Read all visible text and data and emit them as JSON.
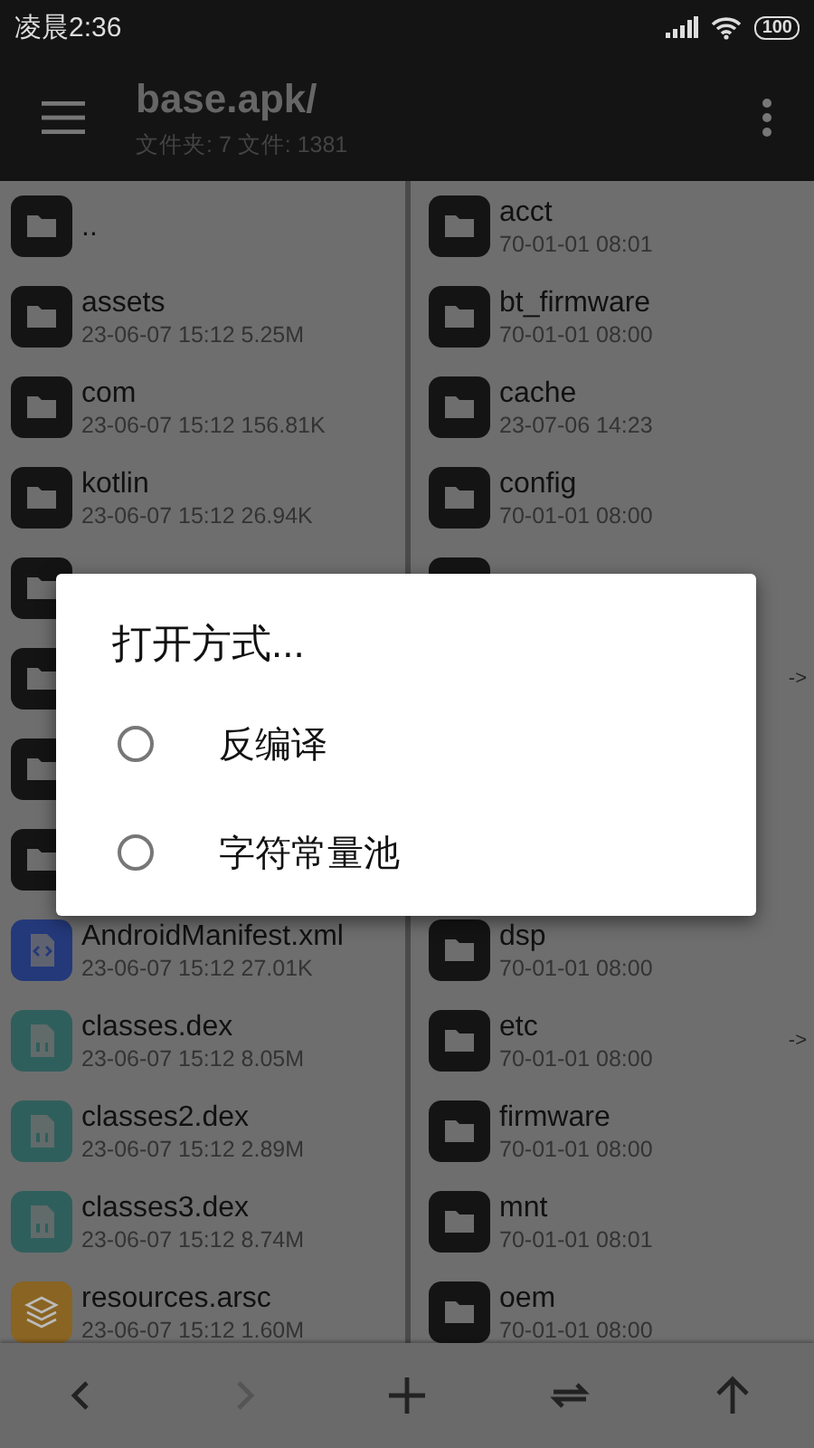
{
  "status_bar": {
    "time": "凌晨2:36",
    "battery": "100"
  },
  "toolbar": {
    "title": "base.apk/",
    "subtitle": "文件夹: 7  文件: 1381"
  },
  "left_pane": {
    "rows": [
      {
        "kind": "folder",
        "name": ".."
      },
      {
        "kind": "folder",
        "name": "assets",
        "meta": "23-06-07 15:12  5.25M"
      },
      {
        "kind": "folder",
        "name": "com",
        "meta": "23-06-07 15:12  156.81K"
      },
      {
        "kind": "folder",
        "name": "kotlin",
        "meta": "23-06-07 15:12  26.94K"
      },
      {
        "kind": "folder"
      },
      {
        "kind": "folder"
      },
      {
        "kind": "folder"
      },
      {
        "kind": "folder"
      },
      {
        "kind": "xml",
        "name": "AndroidManifest.xml",
        "meta": "23-06-07 15:12  27.01K"
      },
      {
        "kind": "dex",
        "name": "classes.dex",
        "meta": "23-06-07 15:12  8.05M"
      },
      {
        "kind": "dex",
        "name": "classes2.dex",
        "meta": "23-06-07 15:12  2.89M"
      },
      {
        "kind": "dex",
        "name": "classes3.dex",
        "meta": "23-06-07 15:12  8.74M"
      },
      {
        "kind": "arsc",
        "name": "resources.arsc",
        "meta": "23-06-07 15:12  1.60M"
      }
    ]
  },
  "right_pane": {
    "rows": [
      {
        "kind": "folder",
        "name": "acct",
        "meta": "70-01-01 08:01"
      },
      {
        "kind": "folder",
        "name": "bt_firmware",
        "meta": "70-01-01 08:00"
      },
      {
        "kind": "folder",
        "name": "cache",
        "meta": "23-07-06 14:23"
      },
      {
        "kind": "folder",
        "name": "config",
        "meta": "70-01-01 08:00"
      },
      {
        "kind": "folder"
      },
      {
        "kind": "hidden",
        "link": "->"
      },
      {
        "kind": "hidden"
      },
      {
        "kind": "hidden"
      },
      {
        "kind": "folder",
        "name": "dsp",
        "meta": "70-01-01 08:00"
      },
      {
        "kind": "folder",
        "name": "etc",
        "meta": "70-01-01 08:00",
        "link": "->"
      },
      {
        "kind": "folder",
        "name": "firmware",
        "meta": "70-01-01 08:00"
      },
      {
        "kind": "folder",
        "name": "mnt",
        "meta": "70-01-01 08:01"
      },
      {
        "kind": "folder",
        "name": "oem",
        "meta": "70-01-01 08:00"
      }
    ]
  },
  "bottom_bar": {
    "buttons": [
      {
        "kind": "back",
        "disabled": false
      },
      {
        "kind": "forward",
        "disabled": true
      },
      {
        "kind": "add",
        "disabled": false
      },
      {
        "kind": "swap",
        "disabled": false
      },
      {
        "kind": "up",
        "disabled": false
      }
    ]
  },
  "dialog": {
    "title": "打开方式...",
    "options": [
      {
        "label": "反编译",
        "selected": false
      },
      {
        "label": "字符常量池",
        "selected": false
      }
    ]
  }
}
